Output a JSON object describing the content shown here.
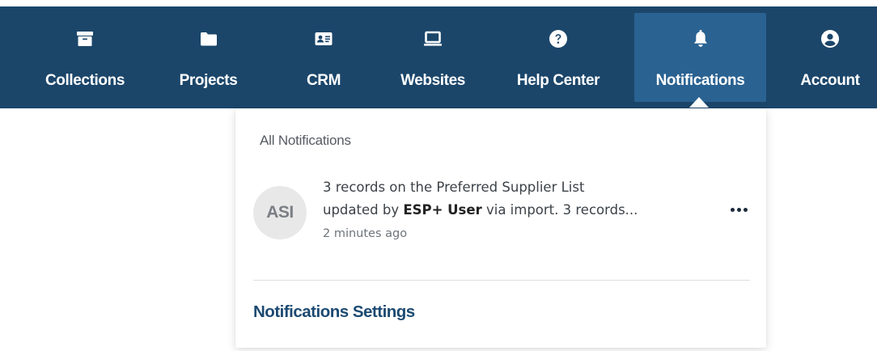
{
  "nav": {
    "items": [
      {
        "label": "Collections",
        "icon": "archive-box-icon"
      },
      {
        "label": "Projects",
        "icon": "folder-icon"
      },
      {
        "label": "CRM",
        "icon": "contact-card-icon"
      },
      {
        "label": "Websites",
        "icon": "laptop-icon"
      },
      {
        "label": "Help Center",
        "icon": "question-circle-icon"
      },
      {
        "label": "Notifications",
        "icon": "bell-icon",
        "active": true
      },
      {
        "label": "Account",
        "icon": "user-circle-icon"
      }
    ]
  },
  "notifications": {
    "heading": "All Notifications",
    "items": [
      {
        "avatar": "ASI",
        "line1": "3 records on the Preferred Supplier List",
        "line2_before": "updated by ",
        "line2_bold": "ESP+ User",
        "line2_after": " via import. 3 records...",
        "time": "2 minutes ago"
      }
    ],
    "settings_label": "Notifications Settings"
  },
  "colors": {
    "navbar": "#1b466a",
    "active_tab": "#2a6291",
    "link": "#1c4a72"
  }
}
